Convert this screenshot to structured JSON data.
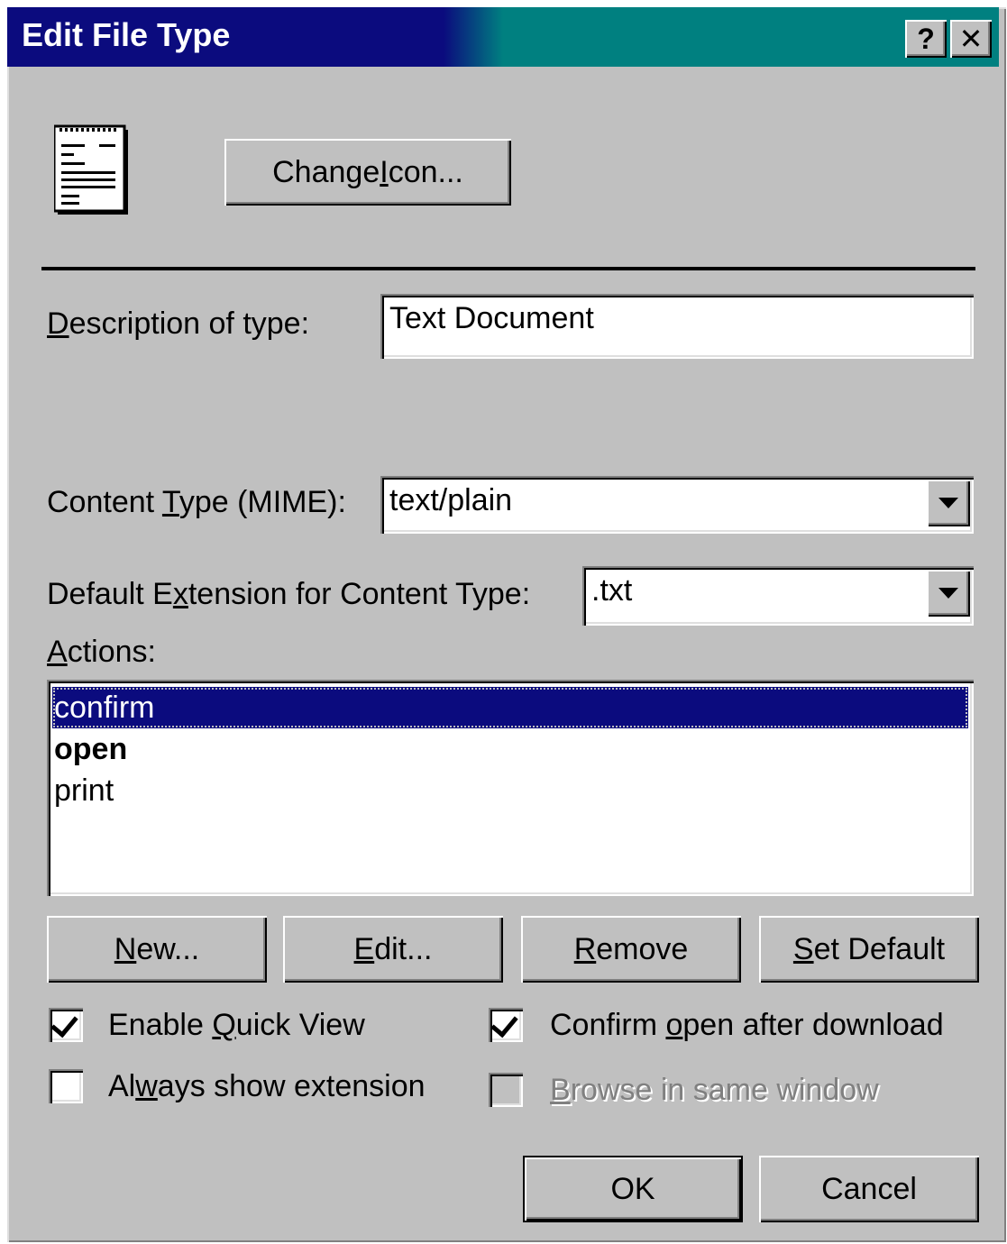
{
  "window": {
    "title": "Edit File Type",
    "help_button": "?",
    "close_button": "✕"
  },
  "icon_section": {
    "file_icon": "text-document-icon",
    "change_icon_button": {
      "pre": "Change ",
      "ul": "I",
      "post": "con..."
    }
  },
  "description": {
    "label": {
      "pre": "",
      "ul": "D",
      "post": "escription of type:"
    },
    "value": "Text Document"
  },
  "content_type": {
    "label": {
      "pre": "Content ",
      "ul": "T",
      "post": "ype (MIME):"
    },
    "value": "text/plain"
  },
  "default_extension": {
    "label": {
      "pre": "Default E",
      "ul": "x",
      "post": "tension for Content Type:"
    },
    "value": ".txt"
  },
  "actions": {
    "label": {
      "pre": "",
      "ul": "A",
      "post": "ctions:"
    },
    "items": [
      "confirm",
      "open",
      "print"
    ],
    "selected_index": 0,
    "default_index": 1
  },
  "action_buttons": {
    "new": {
      "pre": "",
      "ul": "N",
      "post": "ew..."
    },
    "edit": {
      "pre": "",
      "ul": "E",
      "post": "dit..."
    },
    "remove": {
      "pre": "",
      "ul": "R",
      "post": "emove"
    },
    "set_default": {
      "pre": "",
      "ul": "S",
      "post": "et Default"
    }
  },
  "options": {
    "enable_quick_view": {
      "pre": "Enable ",
      "ul": "Q",
      "post": "uick View",
      "checked": true
    },
    "confirm_open": {
      "pre": "Confirm ",
      "ul": "o",
      "post": "pen after download",
      "checked": true
    },
    "always_show_ext": {
      "pre": "Al",
      "ul": "w",
      "post": "ays show extension",
      "checked": false
    },
    "browse_same_window": {
      "pre": "",
      "ul": "B",
      "post": "rowse in same window",
      "checked": false,
      "disabled": true
    }
  },
  "footer": {
    "ok": "OK",
    "cancel": "Cancel"
  },
  "colors": {
    "titlebar_start": "#0b0b7e",
    "titlebar_end": "#008080",
    "face": "#c0c0c0",
    "selection": "#0b0b7e"
  }
}
